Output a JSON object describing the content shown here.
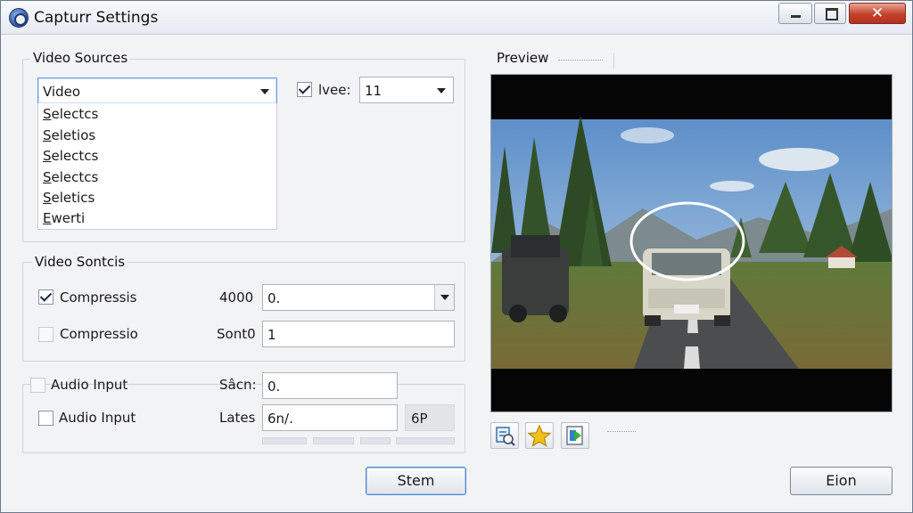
{
  "window": {
    "title": "Capturr Settings"
  },
  "video_sources": {
    "title": "Video Sources",
    "source_combo_value": "Video",
    "dropdown_items": [
      "Selectcs",
      "Seletios",
      "Selectcs",
      "Selectcs",
      "Seletics",
      "Ewerti"
    ],
    "live_checkbox_label": "lvee:",
    "live_checkbox_checked": true,
    "live_combo_value": "11"
  },
  "video_controls": {
    "title": "Video Sontcis",
    "row1": {
      "checkbox_label": "Compressis",
      "checked": true,
      "field_label": "4000",
      "field_value": "0."
    },
    "row2": {
      "checkbox_label": "Compressio",
      "checked": false,
      "field_label": "Sont0",
      "field_value": "1"
    }
  },
  "audio": {
    "row1": {
      "checkbox_label": "Audio Input",
      "checked": false,
      "field_label": "Sâcn:",
      "field_value": "0."
    },
    "row2": {
      "checkbox_label": "Audio Input",
      "checked": false,
      "field_label": "Lates",
      "field_value": "6n/.",
      "aside_value": "6P"
    }
  },
  "preview": {
    "title": "Preview",
    "toolbar_icons": [
      "capture-settings-icon",
      "favorite-star-icon",
      "export-icon"
    ]
  },
  "buttons": {
    "primary": "Stem",
    "secondary": "Eion"
  },
  "colors": {
    "window_bg": "#f2f3f5",
    "close_button": "#c4412a",
    "focus_border": "#6d9fd9"
  }
}
